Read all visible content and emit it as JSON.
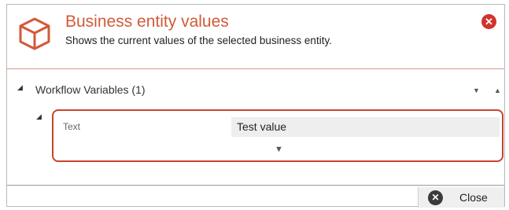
{
  "dialog": {
    "title": "Business entity values",
    "subtitle": "Shows the current values of the selected business entity.",
    "close_icon_glyph": "✕",
    "accent_color": "#d25a38"
  },
  "group": {
    "toggle_glyph": "◢",
    "label": "Workflow Variables (1)",
    "move_down_glyph": "▼",
    "move_up_glyph": "▲"
  },
  "item": {
    "toggle_glyph": "◢",
    "field_label": "Text",
    "field_value": "Test value",
    "expand_glyph": "▼"
  },
  "footer": {
    "close_label": "Close",
    "close_icon_glyph": "✕"
  }
}
